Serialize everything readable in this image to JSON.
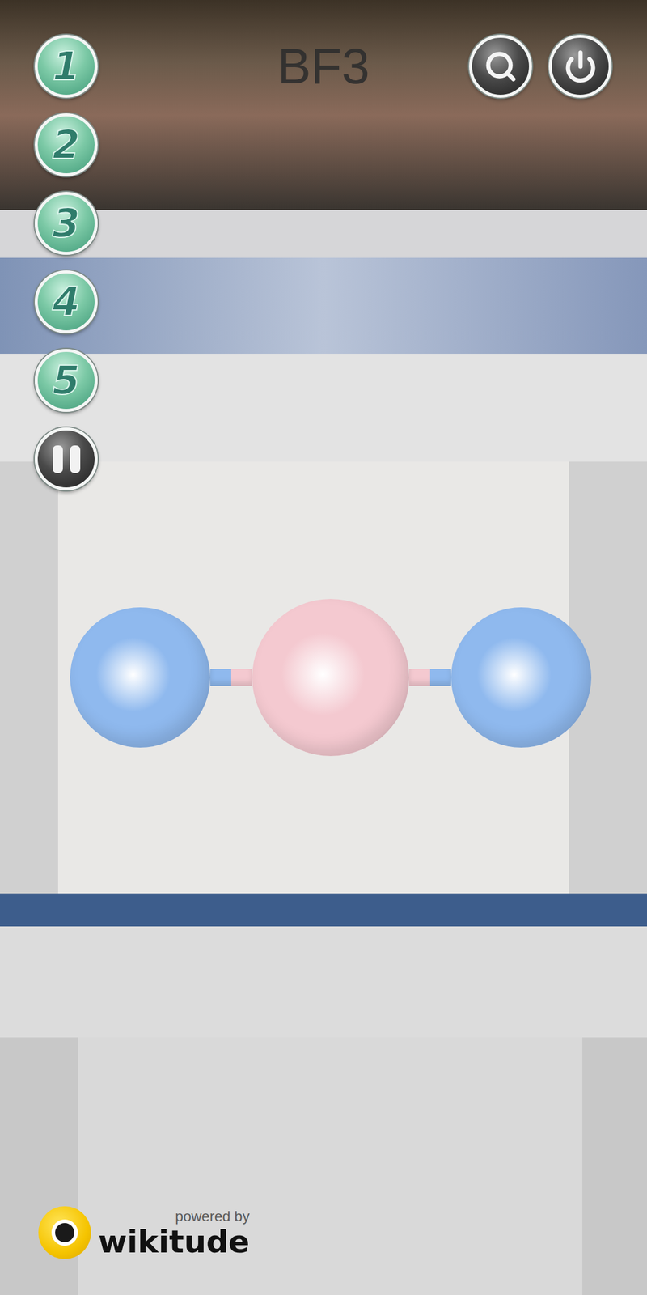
{
  "title": "BF3",
  "number_buttons": [
    {
      "label": "1"
    },
    {
      "label": "2"
    },
    {
      "label": "3"
    },
    {
      "label": "4"
    },
    {
      "label": "5"
    }
  ],
  "molecule": {
    "atoms": [
      {
        "color": "#8fb9ee"
      },
      {
        "color": "#f4c9d0"
      },
      {
        "color": "#8fb9ee"
      }
    ]
  },
  "branding": {
    "powered_by": "powered by",
    "brand": "wikitude"
  }
}
